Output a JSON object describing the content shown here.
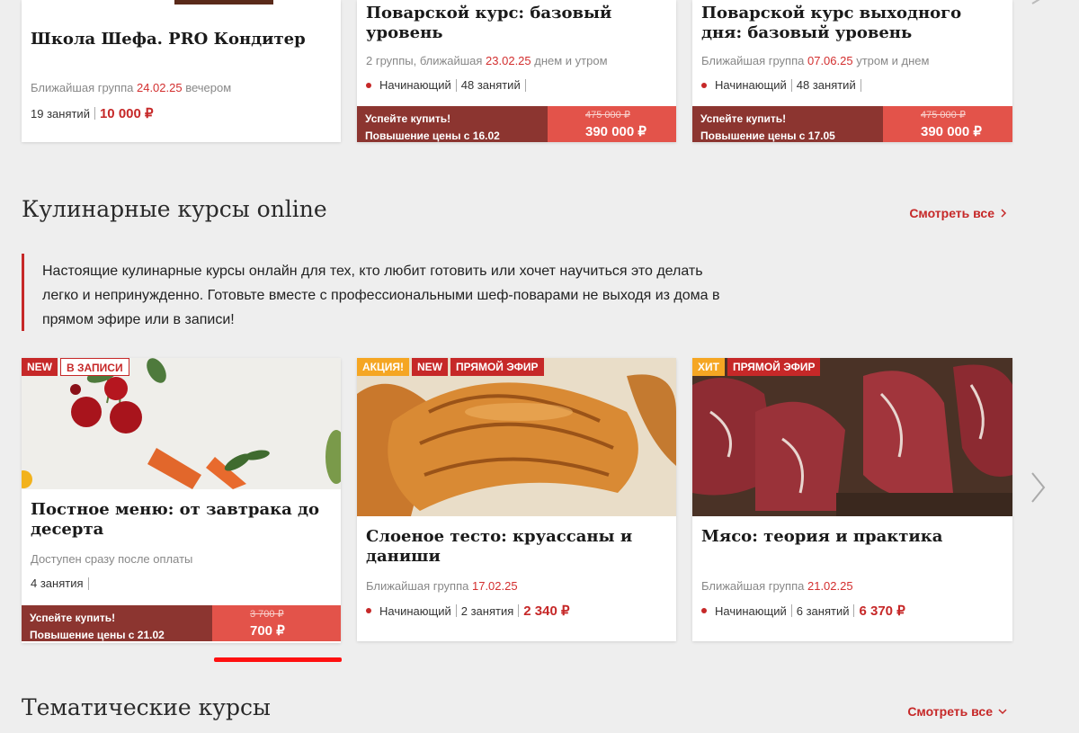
{
  "top_cards": [
    {
      "title": "Школа Шефа. PRO Кондитер",
      "meta_prefix": "Ближайшая группа ",
      "meta_date": "24.02.25",
      "meta_suffix": " вечером",
      "lessons": "19 занятий",
      "price": "10 000 ₽"
    },
    {
      "title": "Поварской курс: базовый уровень",
      "meta_prefix": "2 группы, ближайшая ",
      "meta_date": "23.02.25",
      "meta_suffix": " днем и утром",
      "level": "Начинающий",
      "lessons": "48 занятий",
      "promo_line1": "Успейте купить!",
      "promo_line2": "Повышение цены с 16.02",
      "old_price": "475 000 ₽",
      "price": "390 000 ₽"
    },
    {
      "title": "Поварской курс выходного дня: базовый уровень",
      "meta_prefix": "Ближайшая группа ",
      "meta_date": "07.06.25",
      "meta_suffix": " утром и днем",
      "level": "Начинающий",
      "lessons": "48 занятий",
      "promo_line1": "Успейте купить!",
      "promo_line2": "Повышение цены с 17.05",
      "old_price": "475 000 ₽",
      "price": "390 000 ₽"
    }
  ],
  "online": {
    "title": "Кулинарные курсы online",
    "see_all": "Смотреть все",
    "intro": "Настоящие кулинарные курсы онлайн для тех, кто любит готовить или хочет научиться это делать легко и непринужденно. Готовьте вместе с профессиональными шеф-поварами не выходя из дома в прямом эфире или в записи!",
    "cards": [
      {
        "badges": [
          "NEW",
          "В ЗАПИСИ"
        ],
        "title": "Постное меню: от завтрака до десерта",
        "meta": "Доступен сразу после оплаты",
        "lessons": "4 занятия",
        "promo_line1": "Успейте купить!",
        "promo_line2": "Повышение цены с 21.02",
        "old_price": "3 700 ₽",
        "price": "700 ₽"
      },
      {
        "badges": [
          "АКЦИЯ!",
          "NEW",
          "ПРЯМОЙ ЭФИР"
        ],
        "title": "Слоеное тесто: круассаны и даниши",
        "meta_prefix": "Ближайшая группа ",
        "meta_date": "17.02.25",
        "level": "Начинающий",
        "lessons": "2 занятия",
        "price": "2 340 ₽"
      },
      {
        "badges": [
          "ХИТ",
          "ПРЯМОЙ ЭФИР"
        ],
        "title": "Мясо: теория и практика",
        "meta_prefix": "Ближайшая группа ",
        "meta_date": "21.02.25",
        "level": "Начинающий",
        "lessons": "6 занятий",
        "price": "6 370 ₽"
      }
    ]
  },
  "thematic": {
    "title": "Тематические курсы",
    "see_all": "Смотреть все"
  },
  "colors": {
    "accent": "#c62828",
    "promo_dark": "#8c3530",
    "promo_light": "#e3534a",
    "badge_orange": "#f5a623"
  }
}
